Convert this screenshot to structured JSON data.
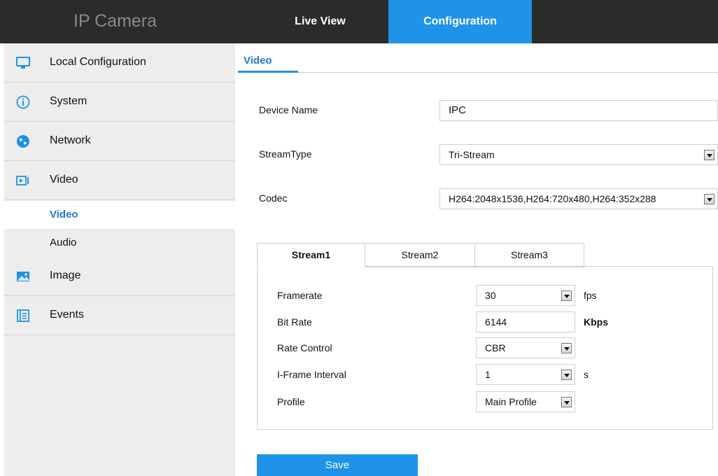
{
  "header": {
    "app_title": "IP Camera",
    "tabs": [
      {
        "label": "Live View",
        "active": false
      },
      {
        "label": "Configuration",
        "active": true
      }
    ]
  },
  "sidebar": {
    "items": [
      {
        "label": "Local Configuration",
        "icon": "monitor-icon"
      },
      {
        "label": "System",
        "icon": "info-icon"
      },
      {
        "label": "Network",
        "icon": "globe-icon"
      },
      {
        "label": "Video",
        "icon": "video-icon"
      },
      {
        "label": "Image",
        "icon": "image-icon"
      },
      {
        "label": "Events",
        "icon": "events-icon"
      }
    ],
    "video_subitems": [
      {
        "label": "Video",
        "active": true
      },
      {
        "label": "Audio",
        "active": false
      }
    ]
  },
  "main": {
    "title": "Video",
    "device_name": {
      "label": "Device Name",
      "value": "IPC"
    },
    "stream_type": {
      "label": "StreamType",
      "value": "Tri-Stream"
    },
    "codec": {
      "label": "Codec",
      "value": "H264:2048x1536,H264:720x480,H264:352x288"
    },
    "stream_tabs": [
      {
        "label": "Stream1",
        "active": true
      },
      {
        "label": "Stream2",
        "active": false
      },
      {
        "label": "Stream3",
        "active": false
      }
    ],
    "stream_fields": {
      "framerate": {
        "label": "Framerate",
        "value": "30",
        "unit": "fps"
      },
      "bit_rate": {
        "label": "Bit Rate",
        "value": "6144",
        "unit": "Kbps"
      },
      "rate_control": {
        "label": "Rate Control",
        "value": "CBR"
      },
      "iframe_interval": {
        "label": "I-Frame Interval",
        "value": "1",
        "unit": "s"
      },
      "profile": {
        "label": "Profile",
        "value": "Main Profile"
      }
    },
    "save_label": "Save"
  },
  "colors": {
    "accent": "#1f93e8",
    "topbar": "#2b2b2b",
    "sidebar_bg": "#ededed",
    "active_text": "#1f78d1"
  }
}
